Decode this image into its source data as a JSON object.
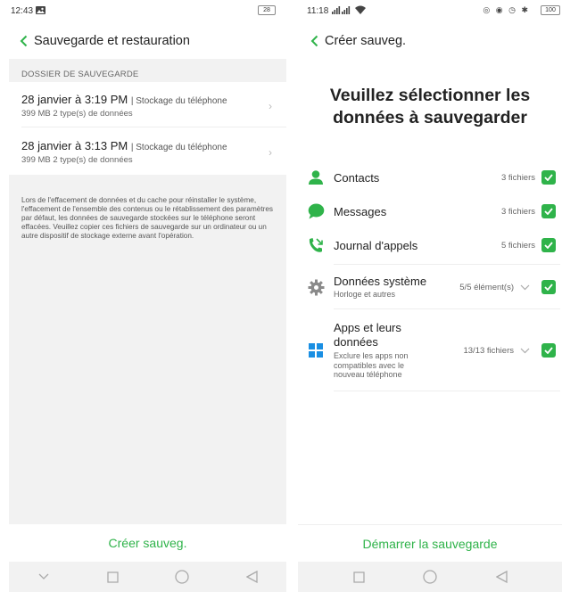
{
  "colors": {
    "accent": "#2fb34a",
    "background_gray": "#f2f2f2"
  },
  "left": {
    "status": {
      "time": "12:43",
      "battery": "28"
    },
    "header": {
      "title": "Sauvegarde et restauration"
    },
    "section_label": "DOSSIER DE SAUVEGARDE",
    "backups": [
      {
        "date": "28 janvier à 3:19 PM",
        "location": "Stockage du téléphone",
        "details": "399 MB  2  type(s) de données"
      },
      {
        "date": "28 janvier à 3:13 PM",
        "location": "Stockage du téléphone",
        "details": "399 MB  2  type(s) de données"
      }
    ],
    "note": "Lors de l'effacement de données et du cache pour réinstaller le système, l'effacement de l'ensemble des contenus ou le rétablissement des paramètres par défaut, les données de sauvegarde stockées sur le téléphone seront effacées. Veuillez copier ces fichiers de sauvegarde sur un ordinateur ou un autre dispositif de stockage externe avant l'opération.",
    "bottom_button": "Créer sauveg."
  },
  "right": {
    "status": {
      "time": "11:18",
      "battery": "100"
    },
    "header": {
      "title": "Créer sauveg."
    },
    "big_title": "Veuillez sélectionner les données à sauvegarder",
    "items": [
      {
        "icon": "contact-icon",
        "name": "Contacts",
        "count": "3 fichiers",
        "checked": true
      },
      {
        "icon": "message-icon",
        "name": "Messages",
        "count": "3 fichiers",
        "checked": true
      },
      {
        "icon": "call-log-icon",
        "name": "Journal d'appels",
        "count": "5 fichiers",
        "checked": true
      },
      {
        "icon": "gear-icon",
        "name": "Données système",
        "desc": "Horloge et autres",
        "count": "5/5 élément(s)",
        "checked": true,
        "expandable": true
      },
      {
        "icon": "apps-icon",
        "name": "Apps et leurs données",
        "desc": "Exclure les apps non compatibles avec le nouveau téléphone",
        "count": "13/13 fichiers",
        "checked": true,
        "expandable": true
      }
    ],
    "bottom_button": "Démarrer la sauvegarde"
  }
}
